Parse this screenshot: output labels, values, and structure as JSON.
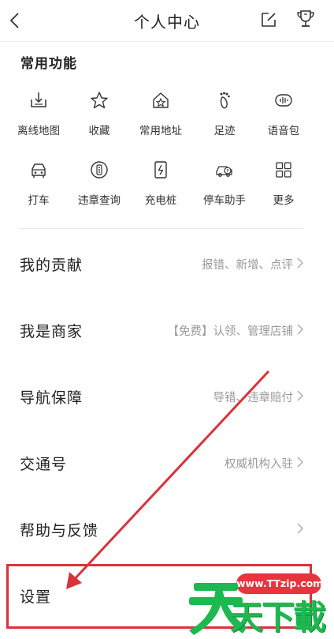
{
  "header": {
    "title": "个人中心"
  },
  "common": {
    "title": "常用功能",
    "items": [
      {
        "label": "离线地图",
        "icon": "offline-map-icon"
      },
      {
        "label": "收藏",
        "icon": "star-icon"
      },
      {
        "label": "常用地址",
        "icon": "home-star-icon"
      },
      {
        "label": "足迹",
        "icon": "footprint-icon"
      },
      {
        "label": "语音包",
        "icon": "voice-pack-icon"
      },
      {
        "label": "打车",
        "icon": "taxi-icon"
      },
      {
        "label": "违章查询",
        "icon": "violation-query-icon"
      },
      {
        "label": "充电桩",
        "icon": "charging-pile-icon"
      },
      {
        "label": "停车助手",
        "icon": "parking-assistant-icon"
      },
      {
        "label": "更多",
        "icon": "grid-more-icon"
      }
    ]
  },
  "rows": [
    {
      "label": "我的贡献",
      "hint": "报错、新增、点评"
    },
    {
      "label": "我是商家",
      "hint": "【免费】认领、管理店铺"
    },
    {
      "label": "导航保障",
      "hint": "导错、违章赔付"
    },
    {
      "label": "交通号",
      "hint": "权威机构入驻"
    },
    {
      "label": "帮助与反馈",
      "hint": ""
    },
    {
      "label": "设置",
      "hint": ""
    }
  ],
  "watermark": {
    "url": "www.TTzip.com",
    "text": "天下載"
  },
  "colors": {
    "annotation": "#d8333a",
    "watermark_green": "#1db84f"
  }
}
